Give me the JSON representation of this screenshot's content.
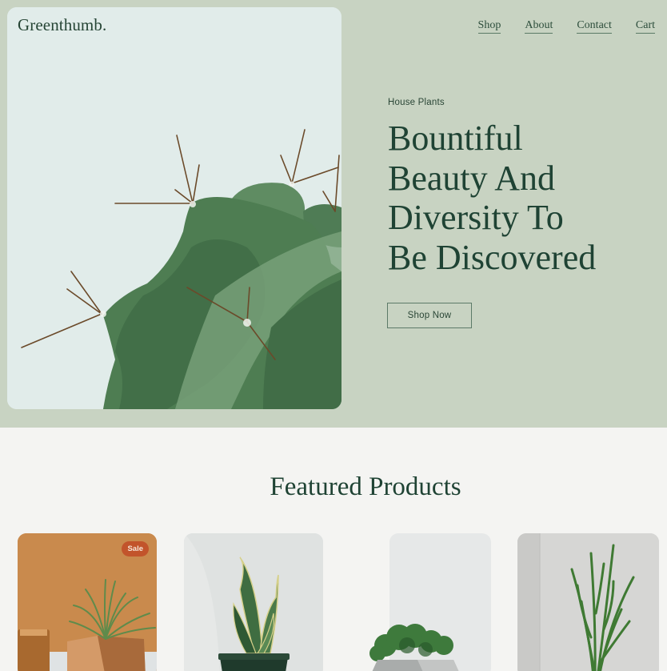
{
  "brand": {
    "logo": "Greenthumb."
  },
  "nav": {
    "items": [
      {
        "label": "Shop"
      },
      {
        "label": "About"
      },
      {
        "label": "Contact"
      },
      {
        "label": "Cart"
      }
    ]
  },
  "hero": {
    "eyebrow": "House Plants",
    "headline_lines": [
      "Bountiful",
      "Beauty And",
      "Diversity To",
      "Be Discovered"
    ],
    "cta_label": "Shop Now",
    "image_alt": "Close-up of a green cactus with spines"
  },
  "featured": {
    "title": "Featured Products",
    "products": [
      {
        "image": "air plant in wooden pot on orange background",
        "badge": "Sale"
      },
      {
        "image": "snake plant in dark green pot"
      },
      {
        "image": "moss in geometric concrete pot"
      },
      {
        "image": "pencil cactus against white wall"
      }
    ]
  },
  "colors": {
    "hero_bg": "#c8d3c2",
    "page_bg": "#f4f4f2",
    "text_dark_green": "#1f4334",
    "sale_badge": "#c2542b"
  }
}
